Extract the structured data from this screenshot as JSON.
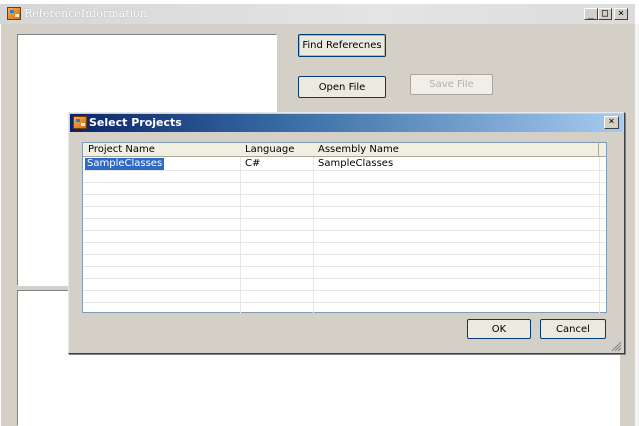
{
  "main_window": {
    "title": "ReferenceInformation",
    "caption_buttons": [
      "_",
      "□",
      "×"
    ],
    "buttons": {
      "find_references": "Find Referecnes",
      "open_file": "Open File",
      "save_file": "Save File"
    }
  },
  "dialog": {
    "title": "Select Projects",
    "close_glyph": "×",
    "columns": [
      "Project Name",
      "Language",
      "Assembly Name"
    ],
    "rows": [
      {
        "project_name": "SampleClasses",
        "language": "C#",
        "assembly_name": "SampleClasses",
        "selected": true
      }
    ],
    "ok_label": "OK",
    "cancel_label": "Cancel"
  },
  "colors": {
    "dialog_title_start": "#0a246a",
    "dialog_title_end": "#a6caf0",
    "selection": "#316ac5",
    "window_face": "#d4d0c8"
  },
  "icons": {
    "main_app": "app-icon",
    "dialog_app": "app-icon",
    "resize_grip": "resize-grip-icon"
  }
}
